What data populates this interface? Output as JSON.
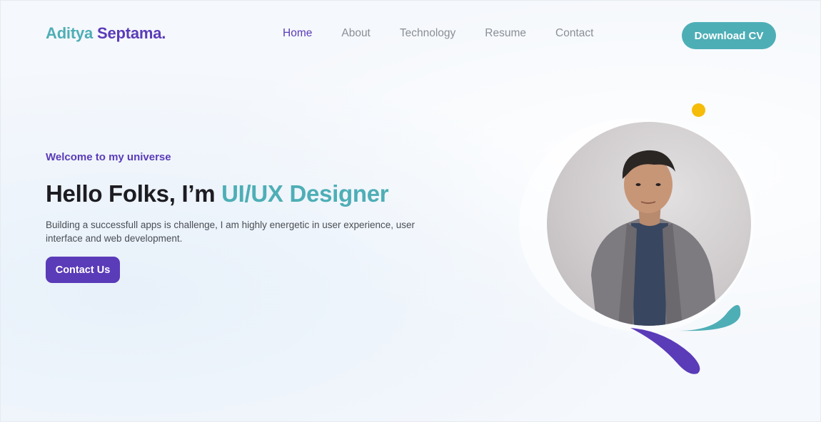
{
  "header": {
    "logo_first": "Aditya",
    "logo_last": "Septama.",
    "nav": [
      {
        "label": "Home",
        "active": true
      },
      {
        "label": "About",
        "active": false
      },
      {
        "label": "Technology",
        "active": false
      },
      {
        "label": "Resume",
        "active": false
      },
      {
        "label": "Contact",
        "active": false
      }
    ],
    "download_label": "Download CV"
  },
  "hero": {
    "welcome": "Welcome to my universe",
    "headline_prefix": "Hello Folks, I’m ",
    "headline_accent": "UI/UX Designer",
    "description": "Building a successfull apps is challenge, I am highly energetic in user experience, user interface and web development.",
    "contact_label": "Contact Us"
  },
  "colors": {
    "teal": "#4eaeb6",
    "purple": "#5a3bb8",
    "yellow": "#f5bd0a",
    "heading": "#1c1c22"
  }
}
